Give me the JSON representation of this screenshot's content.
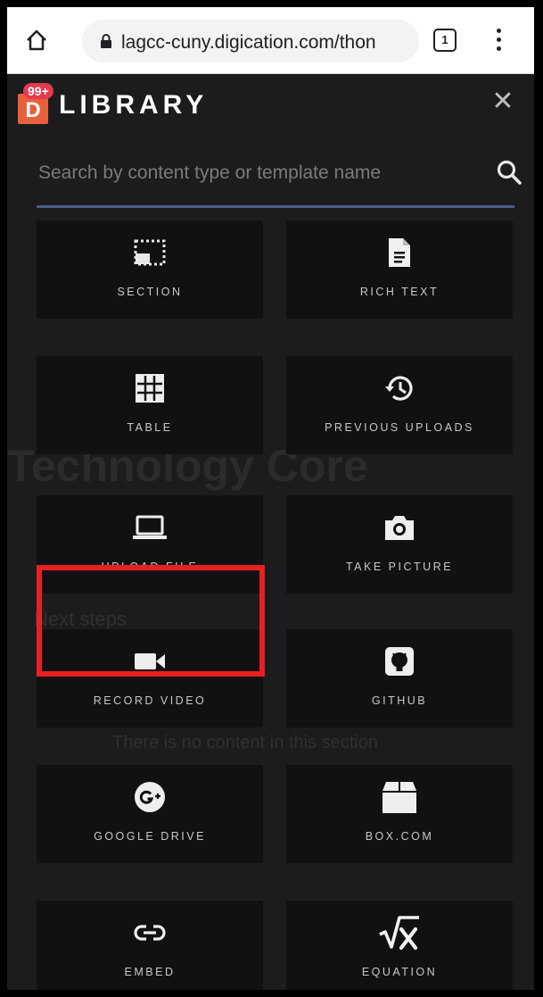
{
  "browser": {
    "url": "lagcc-cuny.digication.com/thon",
    "tab_count": "1"
  },
  "library": {
    "logo_letter": "D",
    "badge": "99+",
    "title": "LIBRARY",
    "close_glyph": "✕",
    "search_placeholder": "Search by content type or template name"
  },
  "background_text": {
    "t1": "Technology Core",
    "t2": "Next steps",
    "t3": "There is no content in this section"
  },
  "tiles": [
    {
      "label": "SECTION",
      "icon": "section-icon"
    },
    {
      "label": "RICH TEXT",
      "icon": "document-icon"
    },
    {
      "label": "TABLE",
      "icon": "table-grid-icon"
    },
    {
      "label": "PREVIOUS UPLOADS",
      "icon": "history-icon"
    },
    {
      "label": "UPLOAD FILE",
      "icon": "laptop-icon"
    },
    {
      "label": "TAKE PICTURE",
      "icon": "camera-icon"
    },
    {
      "label": "RECORD VIDEO",
      "icon": "video-camera-icon"
    },
    {
      "label": "GITHUB",
      "icon": "github-icon"
    },
    {
      "label": "GOOGLE DRIVE",
      "icon": "google-plus-icon"
    },
    {
      "label": "BOX.COM",
      "icon": "box-icon"
    },
    {
      "label": "EMBED",
      "icon": "link-icon"
    },
    {
      "label": "EQUATION",
      "icon": "square-root-icon"
    }
  ],
  "colors": {
    "panel_bg": "#1c1c1e",
    "tile_bg": "#111113",
    "logo_accent": "#e8613c",
    "badge": "#e53950",
    "highlight": "#ea1f1f",
    "search_underline": "#4a5d86"
  }
}
